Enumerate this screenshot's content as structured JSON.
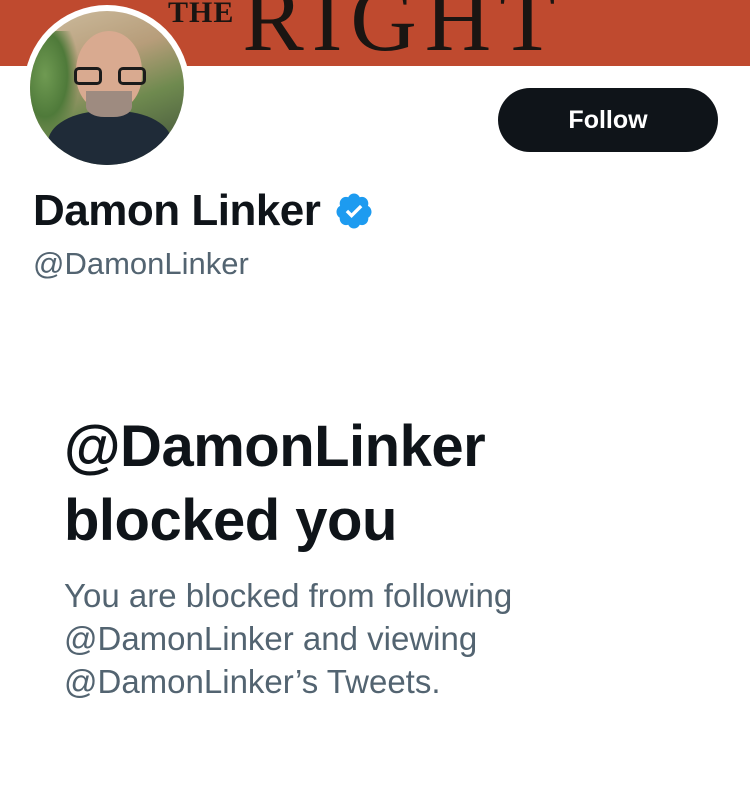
{
  "banner": {
    "small_text": "THE",
    "big_text": "RIGHT",
    "color": "#bf4a2f"
  },
  "profile": {
    "display_name": "Damon Linker",
    "handle": "@DamonLinker",
    "verified": true,
    "avatar_icon": "profile-photo"
  },
  "actions": {
    "follow_label": "Follow"
  },
  "blocked": {
    "title_line1": "@DamonLinker",
    "title_line2": "blocked you",
    "desc_line1": "You are blocked from following",
    "desc_line2": "@DamonLinker and viewing",
    "desc_line3": "@DamonLinker’s Tweets."
  },
  "colors": {
    "text_primary": "#0f1419",
    "text_secondary": "#536471",
    "verified_blue": "#1d9bf0",
    "button_bg": "#0f1419"
  }
}
